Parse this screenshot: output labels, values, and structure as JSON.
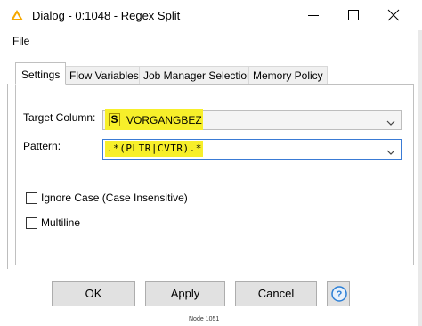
{
  "window": {
    "title": "Dialog - 0:1048 - Regex Split"
  },
  "menu": {
    "file": "File"
  },
  "tabs": [
    {
      "label": "Settings",
      "active": true
    },
    {
      "label": "Flow Variables",
      "active": false
    },
    {
      "label": "Job Manager Selection",
      "active": false
    },
    {
      "label": "Memory Policy",
      "active": false
    }
  ],
  "settings": {
    "target_column_label": "Target Column:",
    "target_column_type_badge": "S",
    "target_column_value": "VORGANGBEZ",
    "pattern_label": "Pattern:",
    "pattern_value": ".*(PLTR|CVTR).*",
    "ignore_case_label": "Ignore Case (Case Insensitive)",
    "ignore_case_checked": false,
    "multiline_label": "Multiline",
    "multiline_checked": false
  },
  "buttons": {
    "ok": "OK",
    "apply": "Apply",
    "cancel": "Cancel"
  },
  "background": {
    "bottom_fragment": "Node 1051"
  },
  "colors": {
    "highlight": "#f7ef2a",
    "focus_border": "#3a7bd5",
    "app_icon": "#f5a800",
    "help_icon": "#2b7fd6"
  }
}
